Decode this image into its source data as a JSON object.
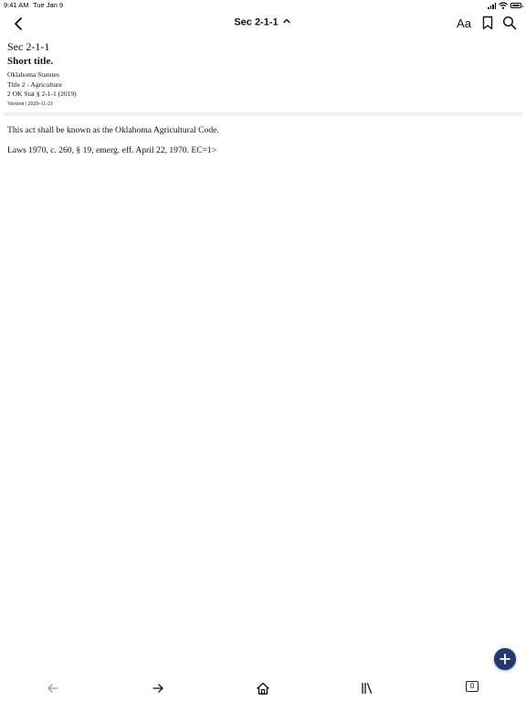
{
  "status_bar": {
    "time": "9:41 AM",
    "date": "Tue Jan 9",
    "icons": [
      "signal-icon",
      "wifi-icon",
      "battery-icon"
    ]
  },
  "nav": {
    "back_icon": "chevron-left-icon",
    "title": "Sec 2-1-1",
    "title_chevron_icon": "chevron-up-icon",
    "font_size_label": "Aa",
    "bookmark_icon": "bookmark-icon",
    "search_icon": "search-icon"
  },
  "document": {
    "section_number": "Sec 2-1-1",
    "section_title": "Short title.",
    "meta": {
      "statutes": "Oklahoma Statutes",
      "title": "Title 2 - Agriculture",
      "citation": "2 OK Stat § 2-1-1 (2019)",
      "version": "Version | 2020-11-21"
    },
    "body": [
      "This act shall be known as the Oklahoma Agricultural Code.",
      "Laws 1970, c. 260, § 19, emerg. eff. April 22, 1970. EC=1>"
    ]
  },
  "fab": {
    "icon": "plus-icon",
    "color": "#1f3a6d"
  },
  "tab_bar": {
    "items": [
      "arrow-left-icon",
      "arrow-right-icon",
      "home-icon",
      "library-icon",
      "tabs-icon"
    ],
    "tab_count": "0"
  }
}
